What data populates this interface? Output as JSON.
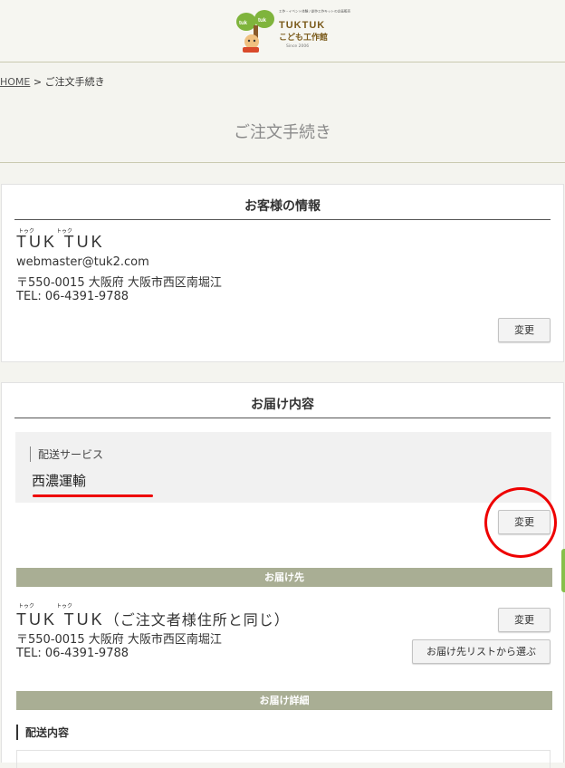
{
  "header": {
    "logo": {
      "tagline": "工作・イベント体験 / 創作工作キットの企画販売",
      "brand": "TUKTUK",
      "sub": "こども工作館",
      "since": "Since 2006"
    }
  },
  "breadcrumb": {
    "home": "HOME",
    "sep": " > ",
    "current": "ご注文手続き"
  },
  "page": {
    "title": "ご注文手続き"
  },
  "customer": {
    "heading": "お客様の情報",
    "name": "TUK TUK",
    "ruby1": "トゥク",
    "ruby2": "トゥク",
    "email": "webmaster@tuk2.com",
    "address": "〒550-0015 大阪府 大阪市西区南堀江",
    "tel": "TEL: 06-4391-9788",
    "change_label": "変更"
  },
  "delivery": {
    "heading": "お届け内容",
    "shipping_label": "配送サービス",
    "shipping_value": "西濃運輸",
    "change_label": "変更",
    "dest_band": "お届け先",
    "dest_name": "TUK TUK",
    "dest_suffix": "（ご注文者様住所と同じ）",
    "dest_ruby1": "トゥク",
    "dest_ruby2": "トゥク",
    "dest_address": "〒550-0015 大阪府 大阪市西区南堀江",
    "dest_tel": "TEL: 06-4391-9788",
    "dest_change_label": "変更",
    "dest_list_label": "お届け先リストから選ぶ",
    "detail_band": "お届け詳細",
    "detail_sub": "配送内容"
  },
  "colors": {
    "accent_band": "#a9ae94",
    "annotation_red": "#e00000"
  }
}
